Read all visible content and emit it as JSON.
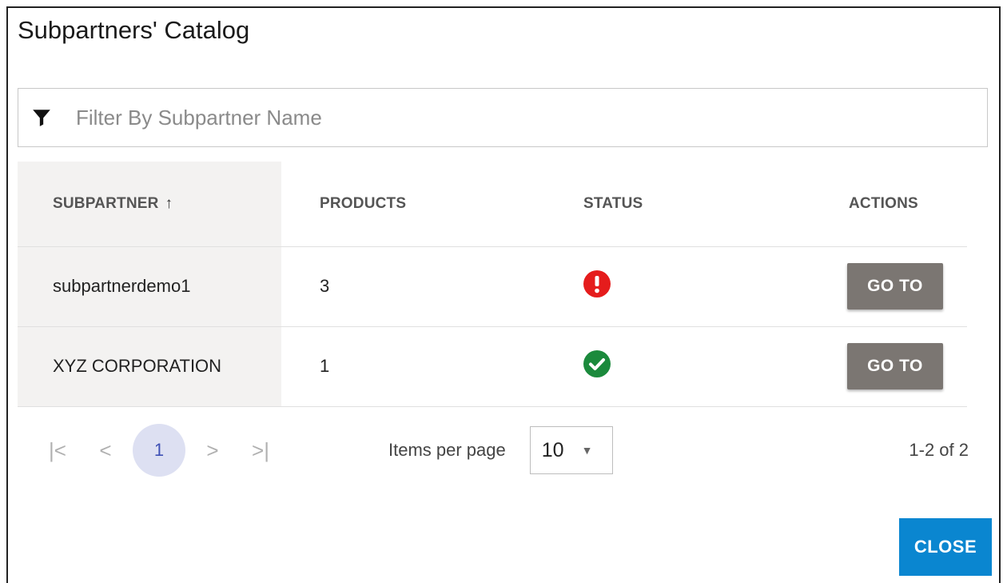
{
  "dialog": {
    "title": "Subpartners' Catalog",
    "close_label": "CLOSE"
  },
  "filter": {
    "placeholder": "Filter By Subpartner Name",
    "value": ""
  },
  "table": {
    "headers": {
      "subpartner": "SUBPARTNER",
      "sort_indicator": "↑",
      "products": "PRODUCTS",
      "status": "STATUS",
      "actions": "ACTIONS"
    },
    "rows": [
      {
        "subpartner": "subpartnerdemo1",
        "products": "3",
        "status": "error",
        "action_label": "GO TO"
      },
      {
        "subpartner": "XYZ CORPORATION",
        "products": "1",
        "status": "ok",
        "action_label": "GO TO"
      }
    ]
  },
  "pager": {
    "current_page": "1",
    "items_per_page_label": "Items per page",
    "items_per_page_value": "10",
    "range_text": "1-2 of 2"
  },
  "colors": {
    "status_error": "#e51c1c",
    "status_ok": "#1b8a3c",
    "goto_button": "#7b7672",
    "close_button": "#0a86d0",
    "current_page_bg": "#dde0f2"
  }
}
